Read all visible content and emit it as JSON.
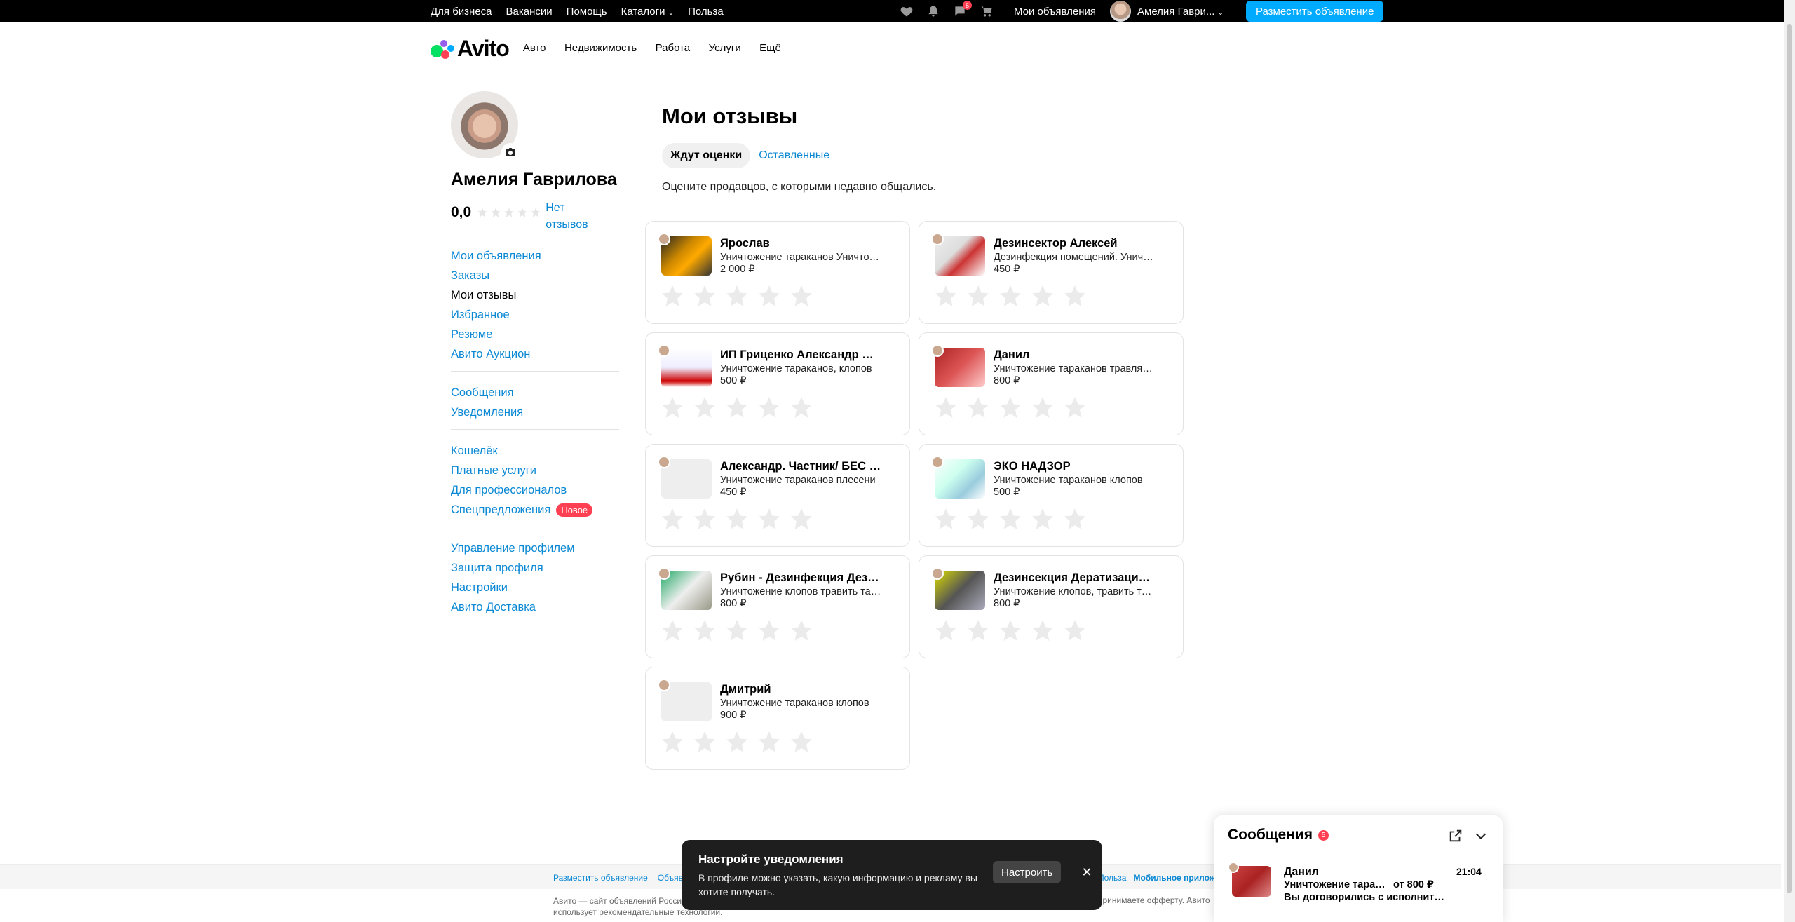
{
  "topbar": {
    "links": [
      "Для бизнеса",
      "Вакансии",
      "Помощь",
      "Каталоги",
      "Польза"
    ],
    "messages_badge": "5",
    "my_ads": "Мои объявления",
    "user_name": "Амелия Гаври...",
    "post_button": "Разместить объявление"
  },
  "header": {
    "logo": "Avito",
    "nav": [
      "Авто",
      "Недвижимость",
      "Работа",
      "Услуги",
      "Ещё"
    ]
  },
  "profile": {
    "name": "Амелия Гаврилова",
    "rating": "0,0",
    "no_reviews": "Нет отзывов"
  },
  "menu": {
    "group1": [
      "Мои объявления",
      "Заказы",
      "Мои отзывы",
      "Избранное",
      "Резюме",
      "Авито Аукцион"
    ],
    "group2": [
      "Сообщения",
      "Уведомления"
    ],
    "group3": [
      "Кошелёк",
      "Платные услуги",
      "Для профессионалов",
      "Спецпредложения"
    ],
    "new_badge": "Новое",
    "group4": [
      "Управление профилем",
      "Защита профиля",
      "Настройки",
      "Авито Доставка"
    ]
  },
  "main": {
    "title": "Мои отзывы",
    "tab_waiting": "Ждут оценки",
    "tab_left": "Оставленные",
    "hint": "Оцените продавцов, с которыми недавно общались."
  },
  "cards": [
    {
      "name": "Ярослав",
      "desc": "Уничтожение тараканов Уничтожение клопов",
      "price": "2 000 ₽"
    },
    {
      "name": "Дезинсектор Алексей",
      "desc": "Дезинфекция помещений. Уничтожение",
      "price": "450 ₽"
    },
    {
      "name": "ИП Гриценко Александр Сергеевич",
      "desc": "Уничтожение тараканов, клопов",
      "price": "500 ₽"
    },
    {
      "name": "Данил",
      "desc": "Уничтожение тараканов травля клопов",
      "price": "800 ₽"
    },
    {
      "name": "Александр. Частник/ БЕС ПОСРЕДНИКОВ",
      "desc": "Уничтожение тараканов плесени",
      "price": "450 ₽"
    },
    {
      "name": "ЭКО НАДЗОР",
      "desc": "Уничтожение тараканов клопов",
      "price": "500 ₽"
    },
    {
      "name": "Рубин - Дезинфекция Дезинсекция",
      "desc": "Уничтожение клопов травить тараканов",
      "price": "800 ₽"
    },
    {
      "name": "Дезинсекция Дератизация Дезинфекция",
      "desc": "Уничтожение клопов, травить тараканов",
      "price": "800 ₽"
    },
    {
      "name": "Дмитрий",
      "desc": "Уничтожение тараканов клопов",
      "price": "900 ₽"
    }
  ],
  "footer": {
    "links": [
      "Разместить объявление",
      "Объявления"
    ],
    "right_text": "принимаете офферту. Авито",
    "copyright_line1": "Авито — сайт объявлений России.",
    "copyright_line2": "использует рекомендательные технологии.",
    "mobile": "Мобильное приложение",
    "benefit": "Польза"
  },
  "toast": {
    "title": "Настройте уведомления",
    "text": "В профиле можно указать, какую информацию и рекламу вы хотите получать.",
    "button": "Настроить"
  },
  "messages": {
    "title": "Сообщения",
    "badge": "5",
    "item": {
      "name": "Данил",
      "time": "21:04",
      "line1": "Уничтожение тараканов травля",
      "price": "от 800 ₽",
      "line2": "Вы договорились с исполнителем"
    }
  },
  "colors": {
    "accent": "#0a88d4",
    "button": "#00aaff",
    "badge": "#ff4053"
  }
}
